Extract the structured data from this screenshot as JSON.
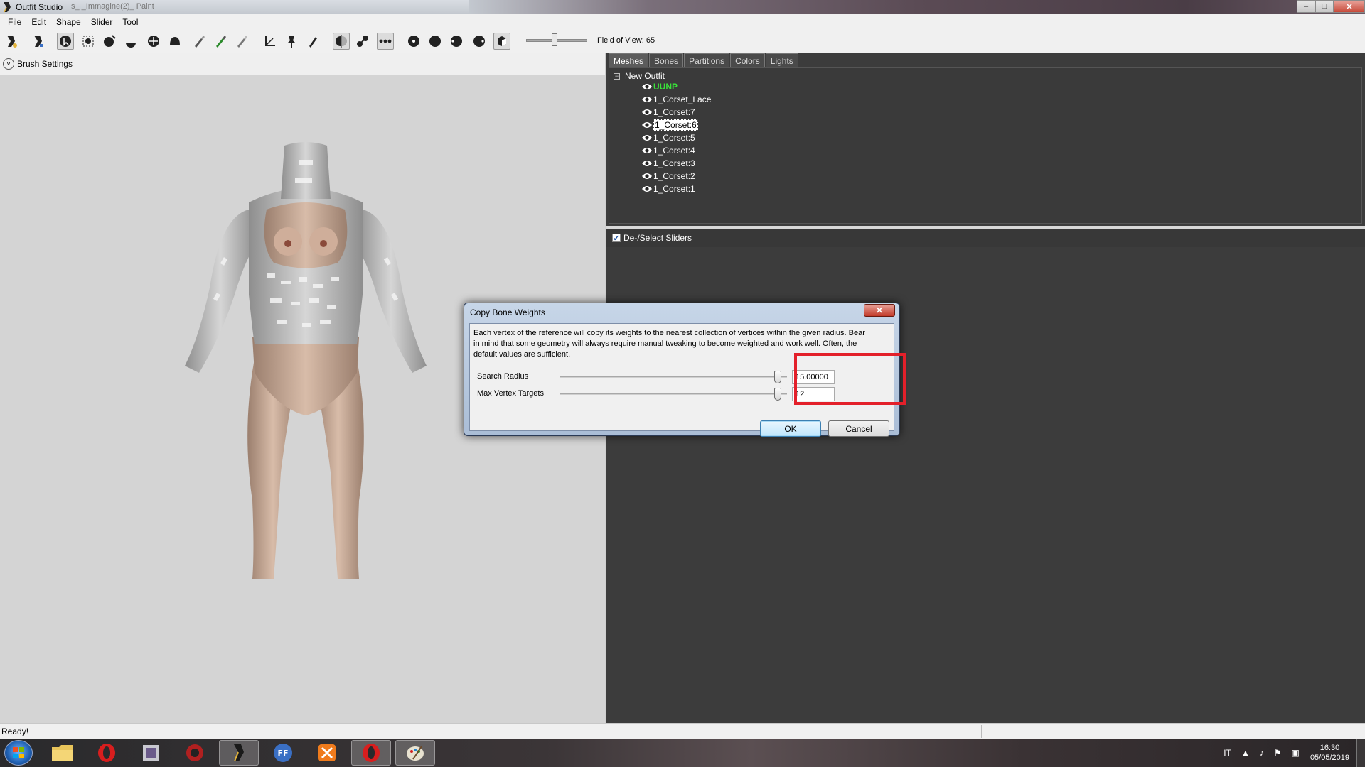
{
  "window": {
    "title": "Outfit Studio",
    "ghost_tab_text": "s_ _Immagine(2)_ Paint",
    "min_glyph": "–",
    "max_glyph": "□",
    "close_glyph": "✕"
  },
  "menu": [
    "File",
    "Edit",
    "Shape",
    "Slider",
    "Tool"
  ],
  "toolbar": {
    "fov_label": "Field of View: 65",
    "fov_value": 65
  },
  "brush_panel": {
    "header": "Brush Settings",
    "chevron_glyph": "˅"
  },
  "tabs": [
    "Meshes",
    "Bones",
    "Partitions",
    "Colors",
    "Lights"
  ],
  "active_tab": "Meshes",
  "mesh_tree": {
    "expander_glyph": "−",
    "root": "New Outfit",
    "items": [
      "UUNP",
      "1_Corset_Lace",
      "1_Corset:7",
      "1_Corset:6",
      "1_Corset:5",
      "1_Corset:4",
      "1_Corset:3",
      "1_Corset:2",
      "1_Corset:1"
    ],
    "reference_item": "UUNP",
    "selected_item": "1_Corset:6"
  },
  "sliders_header": {
    "label": "De-/Select Sliders",
    "checked": true,
    "check_glyph": "✓"
  },
  "dialog": {
    "title": "Copy Bone Weights",
    "close_glyph": "✕",
    "description": "Each vertex of the reference will copy its weights to the nearest collection of vertices within the given radius. Bear in mind that some geometry will always require manual tweaking to become weighted and work well. Often, the default values are sufficient.",
    "search_radius_label": "Search Radius",
    "search_radius_value": "15.00000",
    "max_vertex_label": "Max Vertex Targets",
    "max_vertex_value": "12",
    "ok_label": "OK",
    "cancel_label": "Cancel"
  },
  "status": {
    "text": "Ready!"
  },
  "taskbar": {
    "tray_lang": "IT",
    "tray_icons": [
      "▲",
      "♪",
      "⚑",
      "▣"
    ],
    "time": "16:30",
    "date": "05/05/2019"
  },
  "colors": {
    "reference_mesh": "#39e439",
    "highlight_box": "#e3202a"
  }
}
